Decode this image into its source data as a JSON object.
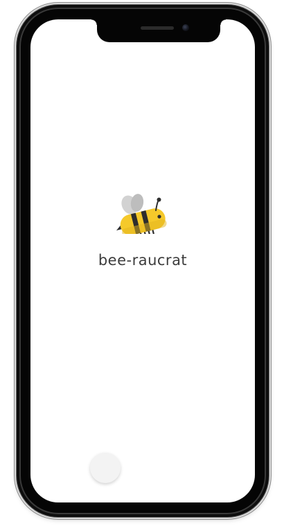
{
  "app": {
    "name": "bee-raucrat"
  },
  "logo": {
    "icon": "bee-icon",
    "colors": {
      "body": "#f5c92b",
      "stripes": "#2d2d2d",
      "wings": "#cfcfcf"
    }
  }
}
